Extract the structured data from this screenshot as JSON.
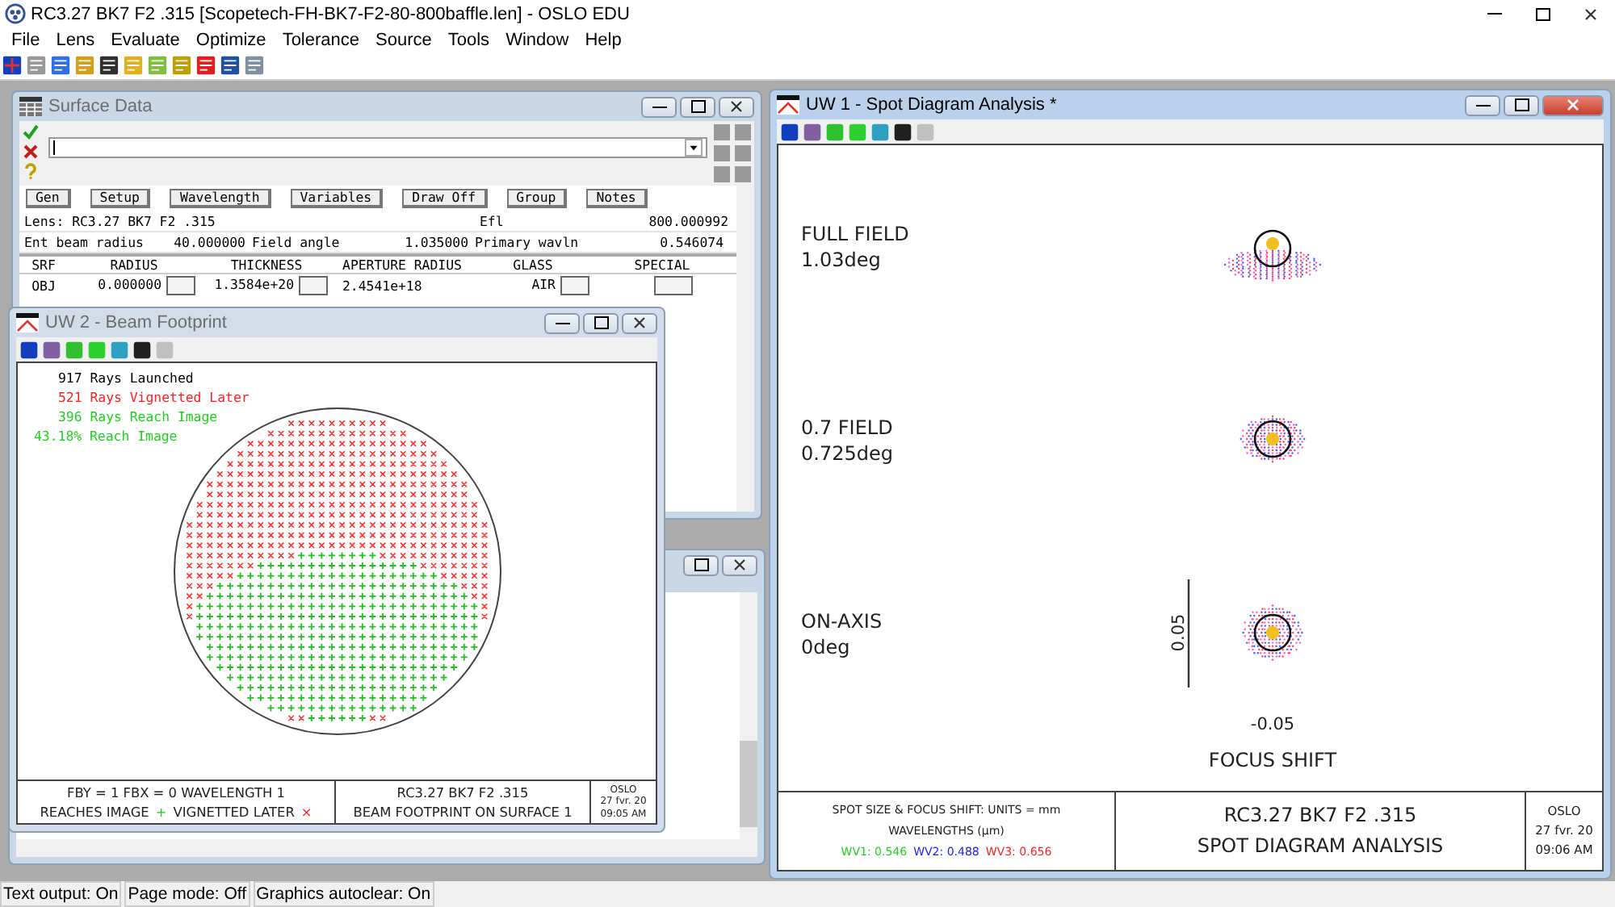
{
  "app": {
    "title": "RC3.27 BK7 F2 .315 [Scopetech-FH-BK7-F2-80-800baffle.len] - OSLO EDU"
  },
  "menu": [
    "File",
    "Lens",
    "Evaluate",
    "Optimize",
    "Tolerance",
    "Source",
    "Tools",
    "Window",
    "Help"
  ],
  "surface_data": {
    "title": "Surface Data",
    "buttons": [
      "Gen",
      "Setup",
      "Wavelength",
      "Variables",
      "Draw Off",
      "Group",
      "Notes"
    ],
    "lens": "Lens: RC3.27 BK7 F2 .315",
    "efl_label": "Efl",
    "efl": "800.000992",
    "ent_label": "Ent beam radius",
    "ent": "40.000000",
    "field_label": "Field angle",
    "field": "1.035000",
    "wavln_label": "Primary wavln",
    "wavln": "0.546074",
    "columns": [
      "SRF",
      "RADIUS",
      "THICKNESS",
      "APERTURE RADIUS",
      "GLASS",
      "SPECIAL"
    ],
    "rows": [
      {
        "srf": "OBJ",
        "radius": "0.000000",
        "thickness": "1.3584e+20",
        "aperture": "2.4541e+18",
        "glass": "AIR"
      }
    ]
  },
  "beam_footprint": {
    "title": "UW 2 - Beam Footprint",
    "stats": [
      {
        "text": "917 Rays Launched",
        "color": "#000000"
      },
      {
        "text": "521 Rays Vignetted Later",
        "color": "#ff2020"
      },
      {
        "text": "396 Rays Reach Image",
        "color": "#20d020"
      },
      {
        "text": "43.18% Reach Image",
        "color": "#20d020"
      }
    ],
    "footer_left": "FBY = 1  FBX = 0  WAVELENGTH 1",
    "legend": [
      {
        "label": "REACHES IMAGE",
        "marker": "+",
        "color": "#20d020"
      },
      {
        "label": "VIGNETTED LATER",
        "marker": "×",
        "color": "#ff2020"
      }
    ],
    "footer_center": [
      "RC3.27 BK7 F2  .315",
      "BEAM FOOTPRINT ON SURFACE 1"
    ],
    "stamp": [
      "OSLO",
      "27 fvr. 20",
      "09:05 AM"
    ]
  },
  "spot_diagram": {
    "title": "UW 1 - Spot Diagram Analysis *",
    "fields": [
      {
        "name": "FULL FIELD",
        "angle": "1.03deg"
      },
      {
        "name": "0.7 FIELD",
        "angle": "0.725deg"
      },
      {
        "name": "ON-AXIS",
        "angle": "0deg"
      }
    ],
    "scale_label": "0.05",
    "focus_value": "-0.05",
    "focus_label": "FOCUS SHIFT",
    "footer_units": "SPOT SIZE & FOCUS SHIFT: UNITS = mm",
    "footer_wavelengths": "WAVELENGTHS (µm)",
    "wavelengths": [
      {
        "label": "WV1: 0.546",
        "color": "#20d020"
      },
      {
        "label": "WV2: 0.488",
        "color": "#2020ff"
      },
      {
        "label": "WV3: 0.656",
        "color": "#ff2020"
      }
    ],
    "footer_center": [
      "RC3.27 BK7 F2 .315",
      "SPOT DIAGRAM ANALYSIS"
    ],
    "stamp": [
      "OSLO",
      "27 fvr. 20",
      "09:06 AM"
    ]
  },
  "status_bar": [
    "Text output: On",
    "Page mode: Off",
    "Graphics autoclear: On"
  ]
}
